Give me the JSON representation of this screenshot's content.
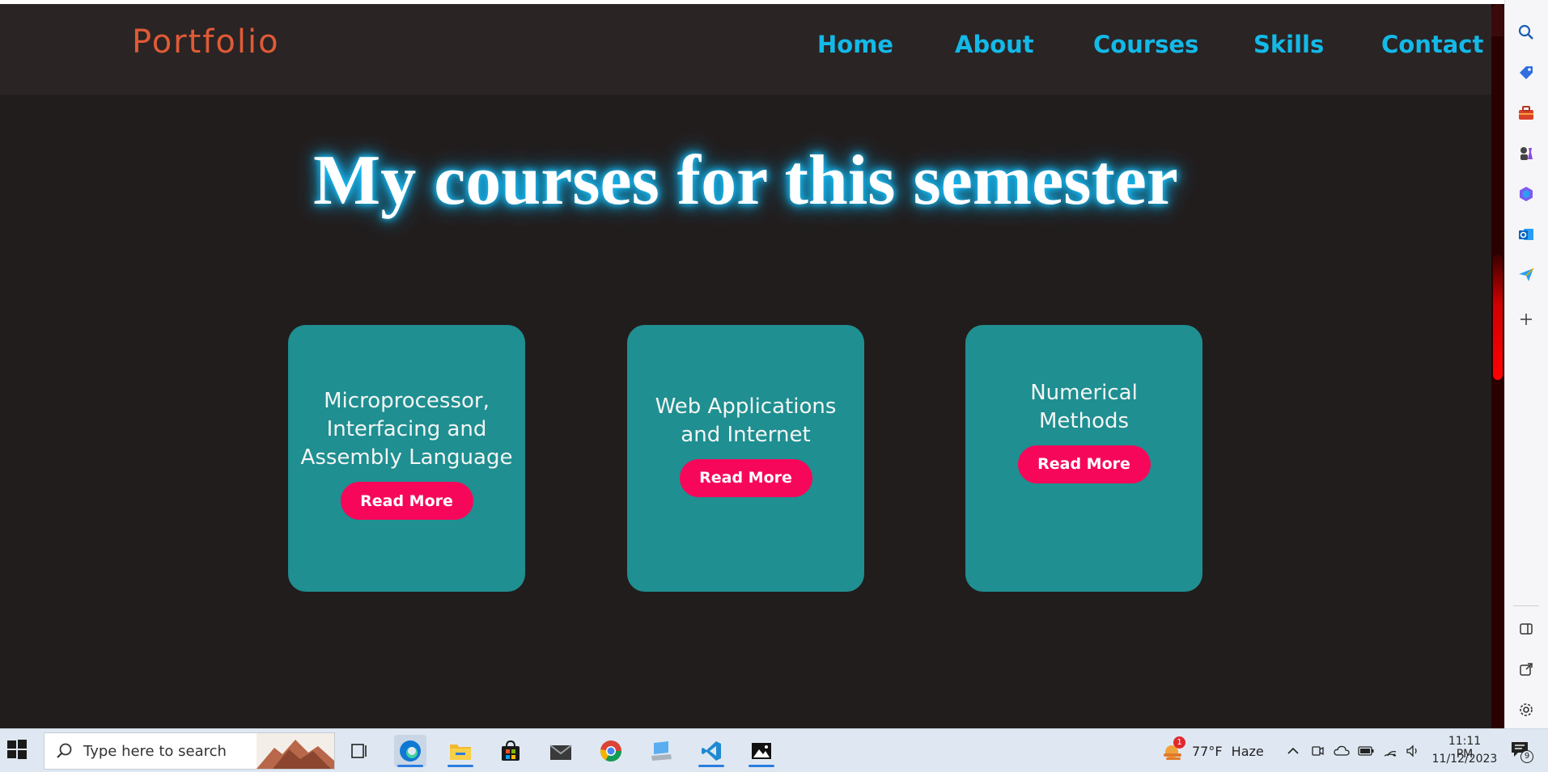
{
  "site": {
    "brand": "Portfolio",
    "nav": [
      "Home",
      "About",
      "Courses",
      "Skills",
      "Contact"
    ],
    "hero_title": "My courses for this semester",
    "cards": [
      {
        "title": "Microprocessor, Interfacing and Assembly Language",
        "button": "Read More"
      },
      {
        "title": "Web Applications and Internet",
        "button": "Read More"
      },
      {
        "title": "Numerical Methods",
        "button": "Read More"
      }
    ],
    "colors": {
      "background": "#221d1d",
      "navbar": "#2a2424",
      "brand": "#e05a36",
      "nav_link": "#13b9e8",
      "card": "#1f8f91",
      "button": "#f7075a",
      "glow": "#19c4ff"
    }
  },
  "edge_sidebar": {
    "icons": [
      "search-icon",
      "tag-icon",
      "toolbox-icon",
      "chess-icon",
      "copilot-icon",
      "outlook-icon",
      "send-icon",
      "plus-icon",
      "sidebar-toggle-icon",
      "external-link-icon",
      "settings-icon"
    ]
  },
  "taskbar": {
    "search_placeholder": "Type here to search",
    "apps": [
      "task-view-icon",
      "edge-icon",
      "file-explorer-icon",
      "store-icon",
      "mail-icon",
      "chrome-icon",
      "this-pc-icon",
      "vscode-icon",
      "photos-icon"
    ],
    "weather": {
      "temp": "77°F",
      "condition": "Haze",
      "badge": "1"
    },
    "clock": {
      "time": "11:11 PM",
      "date": "11/12/2023"
    },
    "notification_count": "9"
  }
}
